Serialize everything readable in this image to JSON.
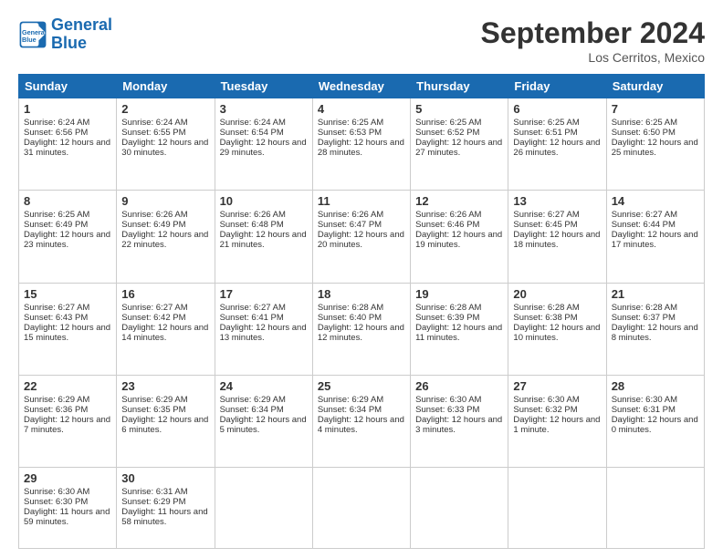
{
  "header": {
    "logo_line1": "General",
    "logo_line2": "Blue",
    "month": "September 2024",
    "location": "Los Cerritos, Mexico"
  },
  "weekdays": [
    "Sunday",
    "Monday",
    "Tuesday",
    "Wednesday",
    "Thursday",
    "Friday",
    "Saturday"
  ],
  "weeks": [
    [
      {
        "day": "1",
        "sunrise": "6:24 AM",
        "sunset": "6:56 PM",
        "daylight": "12 hours and 31 minutes."
      },
      {
        "day": "2",
        "sunrise": "6:24 AM",
        "sunset": "6:55 PM",
        "daylight": "12 hours and 30 minutes."
      },
      {
        "day": "3",
        "sunrise": "6:24 AM",
        "sunset": "6:54 PM",
        "daylight": "12 hours and 29 minutes."
      },
      {
        "day": "4",
        "sunrise": "6:25 AM",
        "sunset": "6:53 PM",
        "daylight": "12 hours and 28 minutes."
      },
      {
        "day": "5",
        "sunrise": "6:25 AM",
        "sunset": "6:52 PM",
        "daylight": "12 hours and 27 minutes."
      },
      {
        "day": "6",
        "sunrise": "6:25 AM",
        "sunset": "6:51 PM",
        "daylight": "12 hours and 26 minutes."
      },
      {
        "day": "7",
        "sunrise": "6:25 AM",
        "sunset": "6:50 PM",
        "daylight": "12 hours and 25 minutes."
      }
    ],
    [
      {
        "day": "8",
        "sunrise": "6:25 AM",
        "sunset": "6:49 PM",
        "daylight": "12 hours and 23 minutes."
      },
      {
        "day": "9",
        "sunrise": "6:26 AM",
        "sunset": "6:49 PM",
        "daylight": "12 hours and 22 minutes."
      },
      {
        "day": "10",
        "sunrise": "6:26 AM",
        "sunset": "6:48 PM",
        "daylight": "12 hours and 21 minutes."
      },
      {
        "day": "11",
        "sunrise": "6:26 AM",
        "sunset": "6:47 PM",
        "daylight": "12 hours and 20 minutes."
      },
      {
        "day": "12",
        "sunrise": "6:26 AM",
        "sunset": "6:46 PM",
        "daylight": "12 hours and 19 minutes."
      },
      {
        "day": "13",
        "sunrise": "6:27 AM",
        "sunset": "6:45 PM",
        "daylight": "12 hours and 18 minutes."
      },
      {
        "day": "14",
        "sunrise": "6:27 AM",
        "sunset": "6:44 PM",
        "daylight": "12 hours and 17 minutes."
      }
    ],
    [
      {
        "day": "15",
        "sunrise": "6:27 AM",
        "sunset": "6:43 PM",
        "daylight": "12 hours and 15 minutes."
      },
      {
        "day": "16",
        "sunrise": "6:27 AM",
        "sunset": "6:42 PM",
        "daylight": "12 hours and 14 minutes."
      },
      {
        "day": "17",
        "sunrise": "6:27 AM",
        "sunset": "6:41 PM",
        "daylight": "12 hours and 13 minutes."
      },
      {
        "day": "18",
        "sunrise": "6:28 AM",
        "sunset": "6:40 PM",
        "daylight": "12 hours and 12 minutes."
      },
      {
        "day": "19",
        "sunrise": "6:28 AM",
        "sunset": "6:39 PM",
        "daylight": "12 hours and 11 minutes."
      },
      {
        "day": "20",
        "sunrise": "6:28 AM",
        "sunset": "6:38 PM",
        "daylight": "12 hours and 10 minutes."
      },
      {
        "day": "21",
        "sunrise": "6:28 AM",
        "sunset": "6:37 PM",
        "daylight": "12 hours and 8 minutes."
      }
    ],
    [
      {
        "day": "22",
        "sunrise": "6:29 AM",
        "sunset": "6:36 PM",
        "daylight": "12 hours and 7 minutes."
      },
      {
        "day": "23",
        "sunrise": "6:29 AM",
        "sunset": "6:35 PM",
        "daylight": "12 hours and 6 minutes."
      },
      {
        "day": "24",
        "sunrise": "6:29 AM",
        "sunset": "6:34 PM",
        "daylight": "12 hours and 5 minutes."
      },
      {
        "day": "25",
        "sunrise": "6:29 AM",
        "sunset": "6:34 PM",
        "daylight": "12 hours and 4 minutes."
      },
      {
        "day": "26",
        "sunrise": "6:30 AM",
        "sunset": "6:33 PM",
        "daylight": "12 hours and 3 minutes."
      },
      {
        "day": "27",
        "sunrise": "6:30 AM",
        "sunset": "6:32 PM",
        "daylight": "12 hours and 1 minute."
      },
      {
        "day": "28",
        "sunrise": "6:30 AM",
        "sunset": "6:31 PM",
        "daylight": "12 hours and 0 minutes."
      }
    ],
    [
      {
        "day": "29",
        "sunrise": "6:30 AM",
        "sunset": "6:30 PM",
        "daylight": "11 hours and 59 minutes."
      },
      {
        "day": "30",
        "sunrise": "6:31 AM",
        "sunset": "6:29 PM",
        "daylight": "11 hours and 58 minutes."
      },
      null,
      null,
      null,
      null,
      null
    ]
  ]
}
